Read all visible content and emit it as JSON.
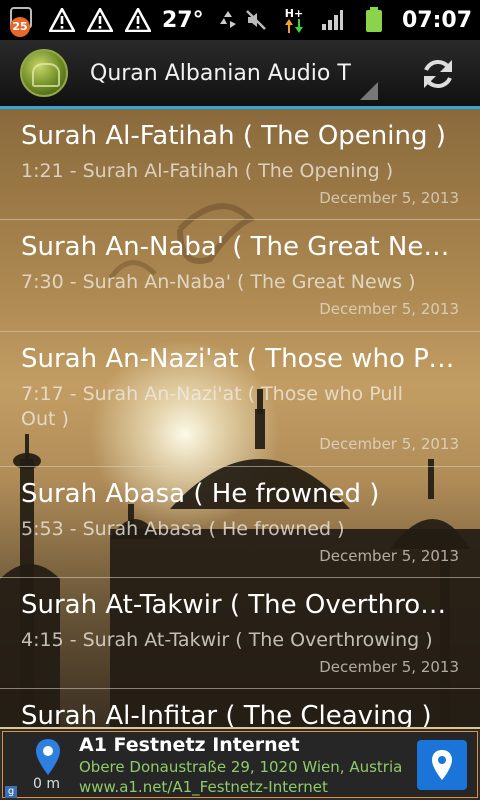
{
  "status_bar": {
    "notification_count": "25",
    "temperature": "27°",
    "network_type": "H+",
    "time": "07:07",
    "icons": [
      "missed-call-badge-icon",
      "warning-icon",
      "warning-icon",
      "warning-icon",
      "recycle-icon",
      "mute-icon",
      "data-arrows-icon",
      "signal-icon",
      "battery-icon"
    ]
  },
  "action_bar": {
    "title": "Quran Albanian Audio T",
    "logo_icon": "quran-logo-icon",
    "refresh_icon": "refresh-icon",
    "accent_color": "#2fa7d8"
  },
  "list": {
    "items": [
      {
        "title": "Surah Al-Fatihah ( The Opening )",
        "subtitle": "1:21 - Surah Al-Fatihah ( The Opening )",
        "date": "December 5, 2013"
      },
      {
        "title": "Surah An-Naba' ( The Great News )",
        "subtitle": "7:30 - Surah An-Naba' ( The Great News )",
        "date": "December 5, 2013"
      },
      {
        "title": "Surah An-Nazi'at ( Those who Pull Out )",
        "subtitle": "7:17 - Surah An-Nazi'at ( Those who Pull Out )",
        "date": "December 5, 2013"
      },
      {
        "title": "Surah Abasa ( He frowned )",
        "subtitle": "5:53 - Surah Abasa ( He frowned )",
        "date": "December 5, 2013"
      },
      {
        "title": "Surah At-Takwir ( The Overthrowing )",
        "subtitle": "4:15 - Surah At-Takwir ( The Overthrowing )",
        "date": "December 5, 2013"
      },
      {
        "title": "Surah Al-Infitar ( The Cleaving )",
        "subtitle": "",
        "date": ""
      }
    ]
  },
  "ad": {
    "title": "A1 Festnetz Internet",
    "address": "Obere Donaustraße 29, 1020 Wien, Austria",
    "url": "www.a1.net/A1_Festnetz-Internet",
    "distance": "0 m",
    "provider_mark": "g",
    "button_color": "#1b74d8"
  }
}
